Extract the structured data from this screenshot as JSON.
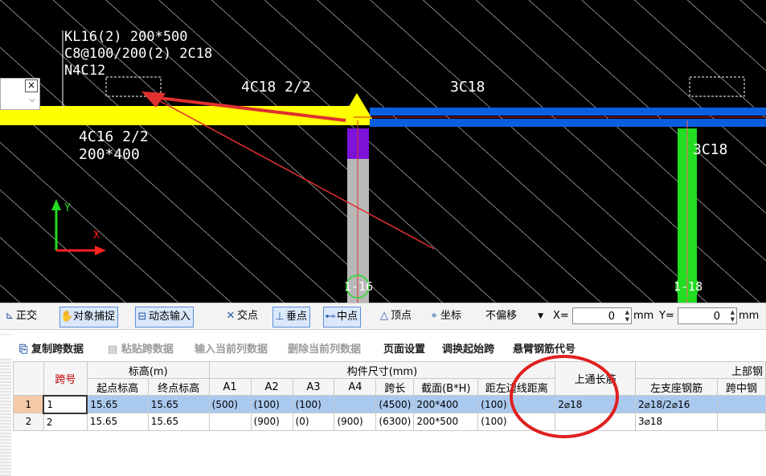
{
  "canvas": {
    "beam_label": [
      "KL16(2) 200*500",
      "C8@100/200(2) 2C18",
      "N4C12"
    ],
    "span1_top": "4C18 2/2",
    "span2_top": "3C18",
    "span1_bottom": [
      "4C16 2/2",
      "200*400"
    ],
    "right_col_label": "3C18",
    "col1_label": "1-16",
    "col2_label": "1-18",
    "axis_y": "Y",
    "axis_x": "X",
    "close_btn": "×",
    "colors": {
      "beam_span1": "#ffff00",
      "beam_span2": "#0a5fe0",
      "column": "#b8b8b8",
      "column_top": "#7d12d8",
      "column_green": "#22dd22",
      "arrow": "#e03030"
    }
  },
  "snapbar": {
    "ortho": "正交",
    "osnap": "对象捕捉",
    "dyn": "动态输入",
    "intersect": "交点",
    "perp": "垂点",
    "mid": "中点",
    "vertex": "顶点",
    "coord": "坐标",
    "offset_mode": "不偏移",
    "x_label": "X=",
    "x_value": "0",
    "mm1": "mm",
    "y_label": "Y=",
    "y_value": "0",
    "mm2": "mm"
  },
  "tablebar": {
    "copy": "复制跨数据",
    "paste": "粘贴跨数据",
    "input_col": "输入当前列数据",
    "delete_col": "删除当前列数据",
    "page_setup": "页面设置",
    "swap_start": "调换起始跨",
    "cantilever": "悬臂钢筋代号"
  },
  "grid": {
    "h1": {
      "span_no": "跨号",
      "elev": "标高(m)",
      "dims": "构件尺寸(mm)",
      "top_rebar": "上通长筋",
      "upper": "上部钢"
    },
    "h2": {
      "start_elev": "起点标高",
      "end_elev": "终点标高",
      "a1": "A1",
      "a2": "A2",
      "a3": "A3",
      "a4": "A4",
      "span_len": "跨长",
      "section": "截面(B*H)",
      "dist": "距左边线距离",
      "left_support": "左支座钢筋",
      "mid_span": "跨中钢"
    },
    "rows": [
      {
        "no": "1",
        "span": "1",
        "start": "15.65",
        "end": "15.65",
        "a1": "(500)",
        "a2": "(100)",
        "a3": "(100)",
        "a4": "",
        "len": "(4500)",
        "sec": "200*400",
        "dist": "(100)",
        "top": "2⌀18",
        "left": "2⌀18/2⌀16",
        "mid": ""
      },
      {
        "no": "2",
        "span": "2",
        "start": "15.65",
        "end": "15.65",
        "a1": "",
        "a2": "(900)",
        "a3": "(0)",
        "a4": "(900)",
        "len": "(6300)",
        "sec": "200*500",
        "dist": "(100)",
        "top": "",
        "left": "3⌀18",
        "mid": ""
      }
    ]
  }
}
